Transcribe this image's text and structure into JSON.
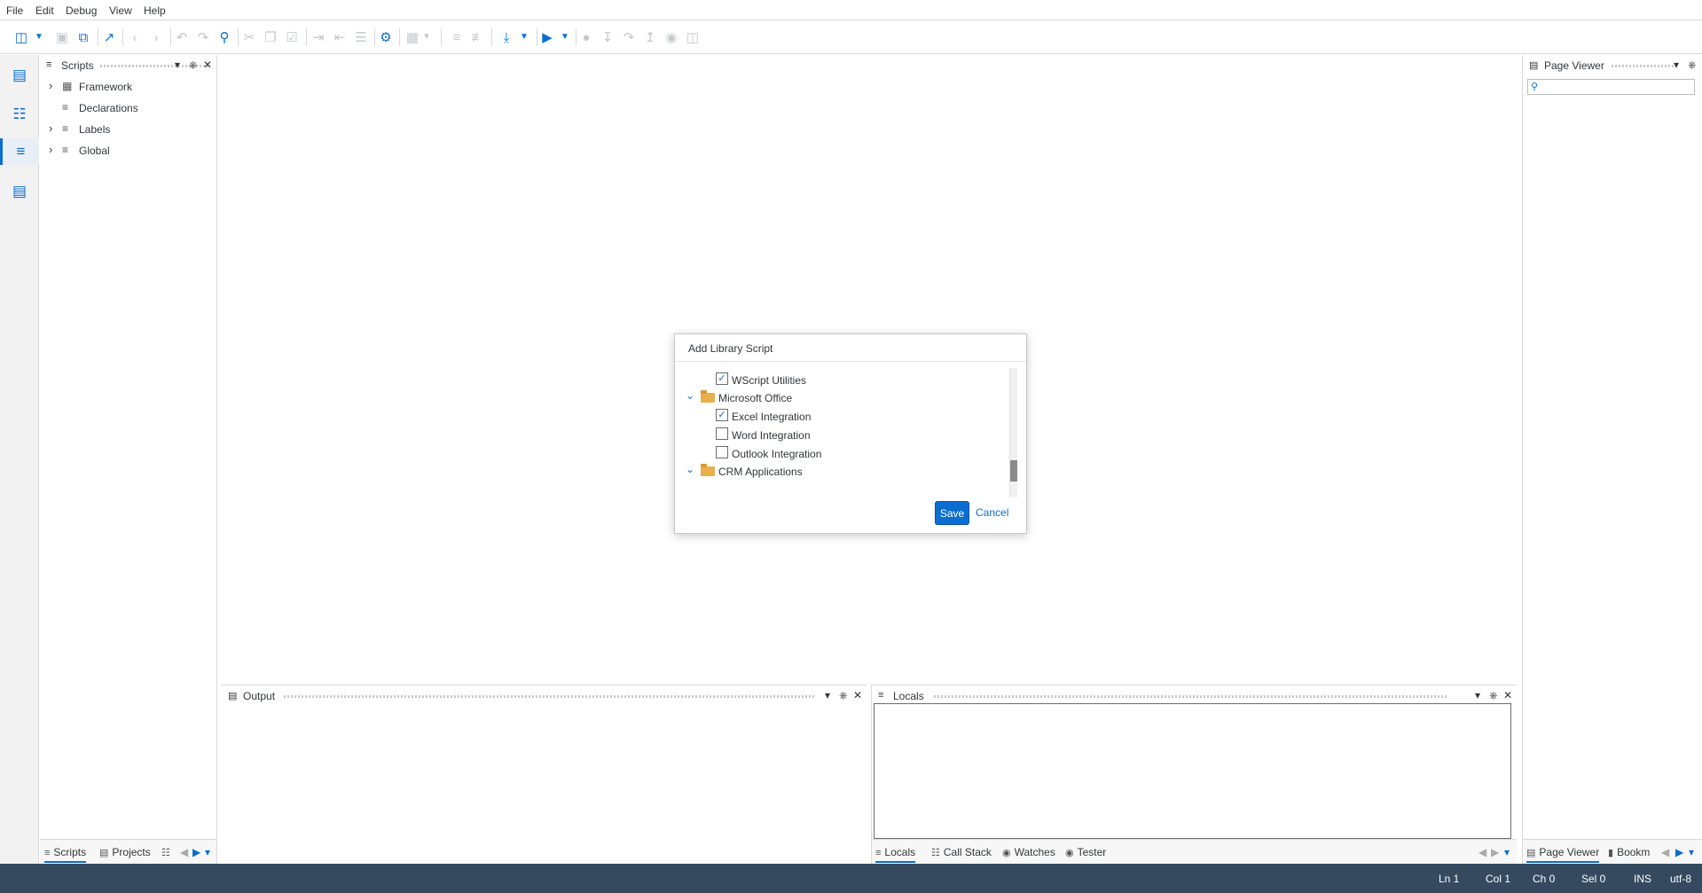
{
  "menu": [
    "File",
    "Edit",
    "Debug",
    "View",
    "Help"
  ],
  "toolbar": {
    "icons": [
      "new-script-icon",
      "save-icon",
      "save-all-icon",
      "export-icon",
      "back-icon",
      "forward-icon",
      "undo-icon",
      "redo-icon",
      "find-icon",
      "cut-icon",
      "copy-icon",
      "paste-icon",
      "indent-icon",
      "outdent-icon",
      "format-icon",
      "settings-icon",
      "breakpoints-icon",
      "comment-icon",
      "uncomment-icon",
      "deploy-icon",
      "run-icon",
      "breakpoint-icon",
      "step-into-icon",
      "step-over-icon",
      "step-out-icon",
      "stop-icon",
      "toggle-icon"
    ]
  },
  "scripts_panel": {
    "title": "Scripts",
    "items": [
      {
        "label": "Framework",
        "expandable": true
      },
      {
        "label": "Declarations",
        "expandable": false
      },
      {
        "label": "Labels",
        "expandable": true
      },
      {
        "label": "Global",
        "expandable": true
      }
    ],
    "tabs": [
      "Scripts",
      "Projects"
    ]
  },
  "output_panel": {
    "title": "Output"
  },
  "locals_panel": {
    "title": "Locals",
    "tabs": [
      "Locals",
      "Call Stack",
      "Watches",
      "Tester"
    ]
  },
  "page_viewer": {
    "title": "Page Viewer",
    "search_placeholder": "",
    "tabs": [
      "Page Viewer",
      "Bookm"
    ]
  },
  "dialog": {
    "title": "Add Library Script",
    "rows": [
      {
        "type": "check",
        "label": "WScript Utilities",
        "checked": true
      },
      {
        "type": "folder",
        "label": "Microsoft Office",
        "expanded": true
      },
      {
        "type": "check",
        "label": "Excel Integration",
        "checked": true
      },
      {
        "type": "check",
        "label": "Word Integration",
        "checked": false
      },
      {
        "type": "check",
        "label": "Outlook Integration",
        "checked": false
      },
      {
        "type": "folder",
        "label": "CRM Applications",
        "expanded": true
      }
    ],
    "save_label": "Save",
    "cancel_label": "Cancel"
  },
  "status": {
    "ln": "Ln 1",
    "col": "Col 1",
    "ch": "Ch 0",
    "sel": "Sel 0",
    "mode": "INS",
    "encoding": "utf-8"
  },
  "colors": {
    "accent": "#0a6ed1",
    "statusbar": "#354a5f",
    "folder": "#e7b04a"
  }
}
